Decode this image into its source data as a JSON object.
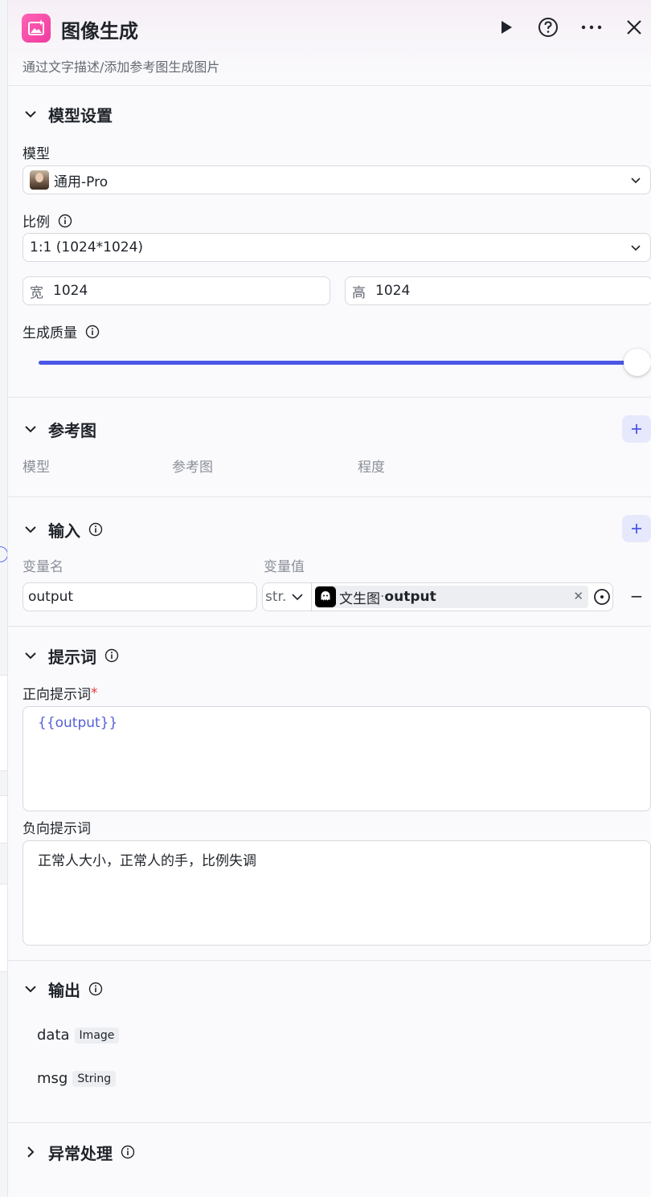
{
  "header": {
    "title": "图像生成",
    "subtitle": "通过文字描述/添加参考图生成图片"
  },
  "model_settings": {
    "title": "模型设置",
    "model_label": "模型",
    "model_value": "通用-Pro",
    "ratio_label": "比例",
    "ratio_value": "1:1 (1024*1024)",
    "width_prefix": "宽",
    "width_value": "1024",
    "height_prefix": "高",
    "height_value": "1024",
    "quality_label": "生成质量",
    "quality_level": 1.0
  },
  "reference": {
    "title": "参考图",
    "col_model": "模型",
    "col_image": "参考图",
    "col_degree": "程度"
  },
  "input": {
    "title": "输入",
    "col_name": "变量名",
    "col_value": "变量值",
    "var_name": "output",
    "var_type": "str.",
    "ref_source": "文生图",
    "ref_separator": " · ",
    "ref_field": "output"
  },
  "prompt": {
    "title": "提示词",
    "positive_label": "正向提示词",
    "required_mark": "*",
    "positive_value": "{{output}}",
    "negative_label": "负向提示词",
    "negative_value": "正常人大小，正常人的手，比例失调"
  },
  "output": {
    "title": "输出",
    "fields": [
      {
        "name": "data",
        "type": "Image"
      },
      {
        "name": "msg",
        "type": "String"
      }
    ]
  },
  "exception": {
    "title": "异常处理"
  },
  "colors": {
    "accent": "#4b57e6",
    "icon_pink": "#f03aa1",
    "variable_text": "#5561d6"
  }
}
